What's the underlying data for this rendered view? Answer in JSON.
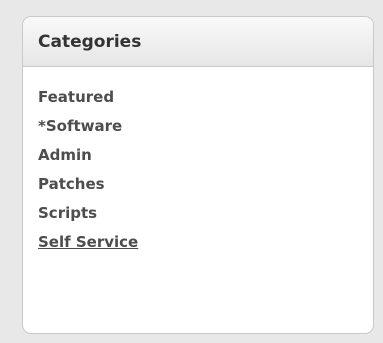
{
  "panel": {
    "title": "Categories",
    "items": [
      {
        "label": "Featured",
        "active": false
      },
      {
        "label": "*Software",
        "active": false
      },
      {
        "label": "Admin",
        "active": false
      },
      {
        "label": "Patches",
        "active": false
      },
      {
        "label": "Scripts",
        "active": false
      },
      {
        "label": "Self Service",
        "active": true
      }
    ]
  },
  "colors": {
    "background": "#e8e8e8",
    "panel": "#ffffff",
    "border": "#c9c9c9",
    "text": "#4d4d4d",
    "title": "#333333"
  }
}
